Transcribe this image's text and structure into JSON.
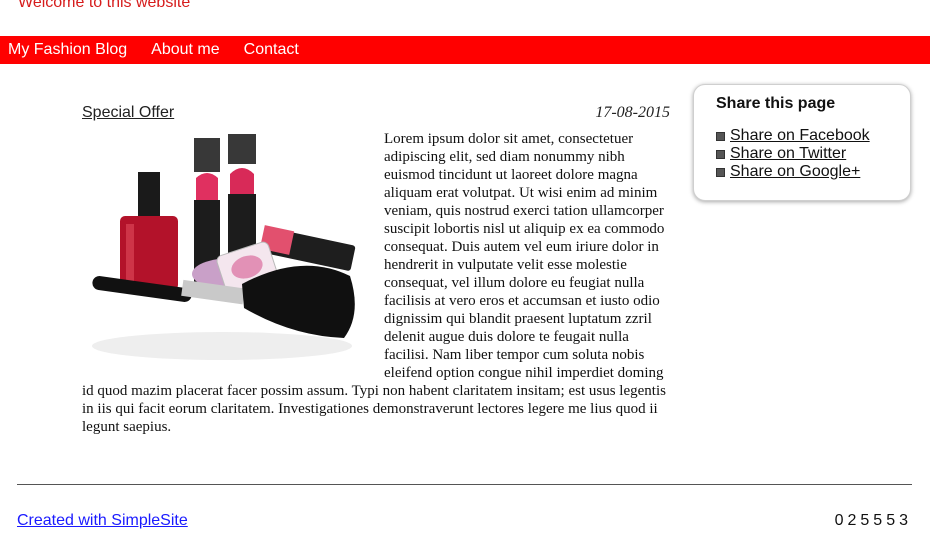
{
  "header": {
    "welcome": "Welcome to this website"
  },
  "nav": {
    "items": [
      {
        "label": "My Fashion Blog"
      },
      {
        "label": "About me"
      },
      {
        "label": "Contact"
      }
    ]
  },
  "post": {
    "title": "Special Offer",
    "date": "17-08-2015",
    "image_alt": "Cosmetics: nail polish, lipsticks, eye shadow and a makeup brush",
    "body": "Lorem ipsum dolor sit amet, consectetuer adipiscing elit, sed diam nonummy nibh euismod tincidunt ut laoreet dolore magna aliquam erat volutpat. Ut wisi enim ad minim veniam, quis nostrud exerci tation ullamcorper suscipit lobortis nisl ut aliquip ex ea commodo consequat. Duis autem vel eum iriure dolor in hendrerit in vulputate velit esse molestie consequat, vel illum dolore eu feugiat nulla facilisis at vero eros et accumsan et iusto odio dignissim qui blandit praesent luptatum zzril delenit augue duis dolore te feugait nulla facilisi. Nam liber tempor cum soluta nobis eleifend option congue nihil imperdiet doming id quod mazim placerat facer possim assum. Typi non habent claritatem insitam; est usus legentis in iis qui facit eorum claritatem. Investigationes demonstraverunt lectores legere me lius quod ii legunt saepius."
  },
  "share": {
    "title": "Share this page",
    "links": [
      {
        "label": "Share on Facebook",
        "icon": "facebook-icon"
      },
      {
        "label": "Share on Twitter",
        "icon": "twitter-icon"
      },
      {
        "label": "Share on Google+",
        "icon": "google-plus-icon"
      }
    ]
  },
  "footer": {
    "created_with": "Created with SimpleSite",
    "counter": "025553"
  },
  "colors": {
    "nav_bg": "#ff0000",
    "welcome": "#d61c1c",
    "link": "#1a1aff"
  }
}
